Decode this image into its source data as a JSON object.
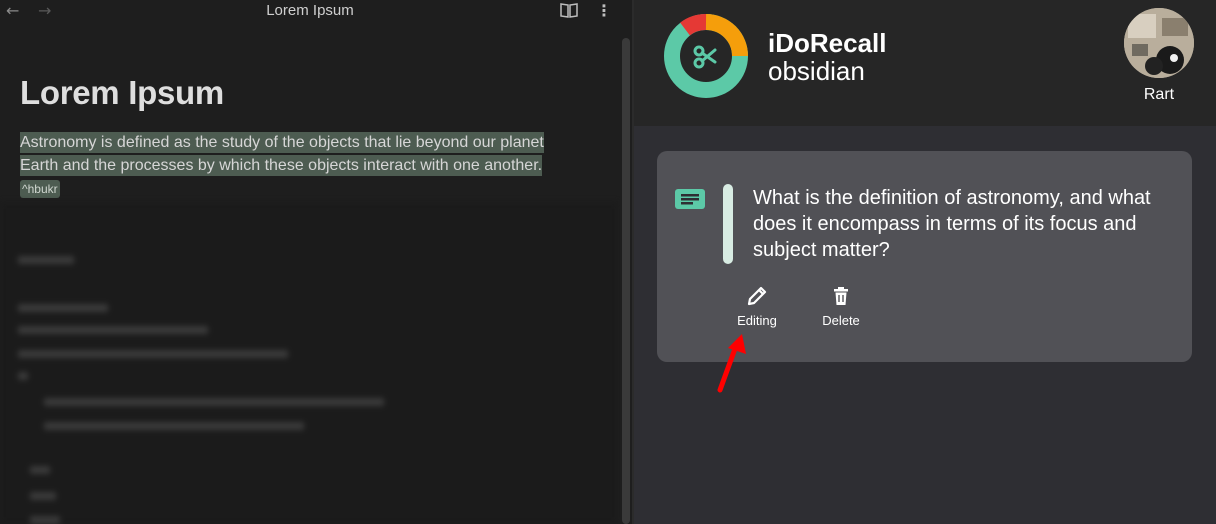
{
  "editor": {
    "tab_title": "Lorem Ipsum",
    "back_icon": "←",
    "forward_icon": "→",
    "more_icon": "⋮",
    "reading_icon": "book-open-icon",
    "heading": "Lorem Ipsum",
    "paragraph_line1": "Astronomy is defined as the study of the objects that lie beyond our planet",
    "paragraph_line2": "Earth and the processes by which these objects interact with one another.",
    "block_id": "^hbukr"
  },
  "plugin": {
    "app_name": "iDoRecall",
    "app_subtitle": "obsidian",
    "user_name": "Rart",
    "card": {
      "question": "What is the definition of astronomy, and what does it encompass in terms of its focus and subject matter?",
      "edit_label": "Editing",
      "delete_label": "Delete"
    }
  },
  "colors": {
    "accent_green": "#5cc9a7",
    "logo_orange": "#f59e0b",
    "logo_red": "#e53935",
    "highlight": "#4d5c51",
    "arrow_red": "#ff0000"
  }
}
